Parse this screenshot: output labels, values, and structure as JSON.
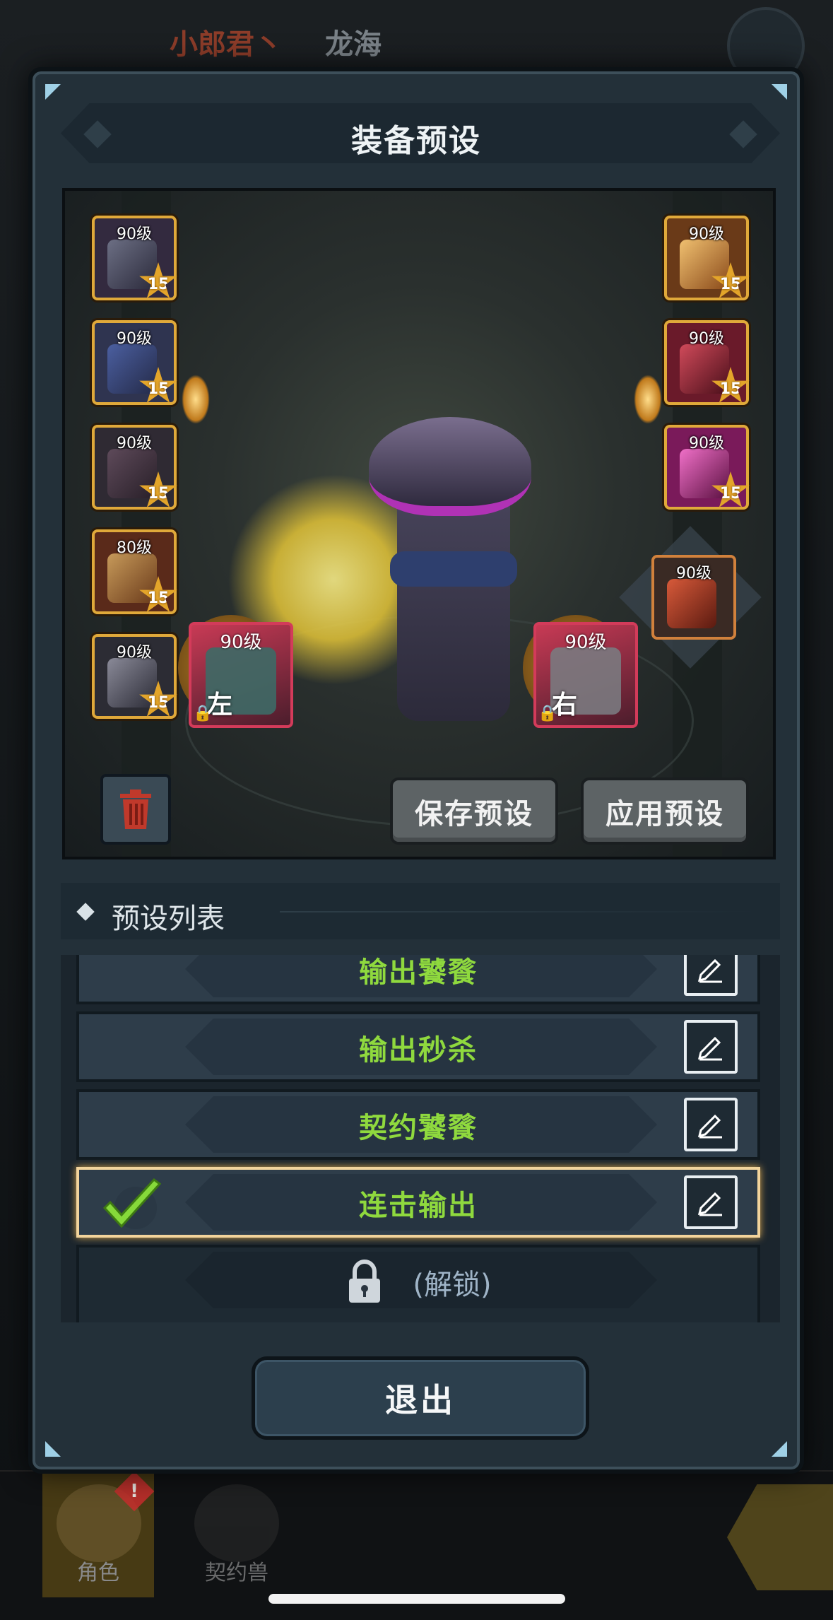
{
  "header": {
    "player_name": "小郎君丶",
    "server_name": "龙海"
  },
  "panel": {
    "title": "装备预设",
    "left_slots": [
      {
        "level": "90级",
        "stars": "15"
      },
      {
        "level": "90级",
        "stars": "15"
      },
      {
        "level": "90级",
        "stars": "15"
      },
      {
        "level": "80级",
        "stars": "15"
      },
      {
        "level": "90级",
        "stars": "15"
      }
    ],
    "right_slots": [
      {
        "level": "90级",
        "stars": "15"
      },
      {
        "level": "90级",
        "stars": "15"
      },
      {
        "level": "90级",
        "stars": "15"
      }
    ],
    "extra_slot": {
      "level": "90级"
    },
    "weapons": {
      "left": {
        "level": "90级",
        "side": "左"
      },
      "right": {
        "level": "90级",
        "side": "右"
      }
    },
    "buttons": {
      "save": "保存预设",
      "apply": "应用预设",
      "exit": "退出"
    },
    "list": {
      "title": "预设列表",
      "presets": [
        {
          "name": "输出饕餮",
          "selected": false
        },
        {
          "name": "输出秒杀",
          "selected": false
        },
        {
          "name": "契约饕餮",
          "selected": false
        },
        {
          "name": "连击输出",
          "selected": true
        }
      ],
      "locked_label": "(解锁)"
    }
  },
  "bottom_nav": {
    "tabs": [
      {
        "label": "角色",
        "badge": "!"
      },
      {
        "label": "契约兽"
      }
    ]
  },
  "colors": {
    "preset_name": "#8fd93e",
    "selected_border": "#f2d49c",
    "slot_border": "#e0a93a",
    "weapon_border": "#d33b5a"
  }
}
